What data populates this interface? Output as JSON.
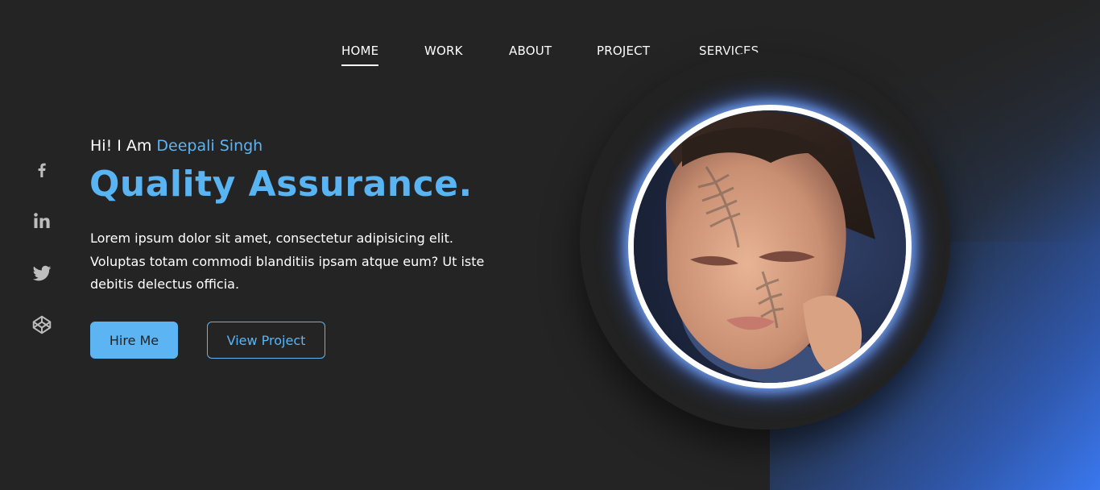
{
  "nav": {
    "items": [
      {
        "label": "HOME",
        "active": true
      },
      {
        "label": "WORK",
        "active": false
      },
      {
        "label": "ABOUT",
        "active": false
      },
      {
        "label": "PROJECT",
        "active": false
      },
      {
        "label": "SERVICES",
        "active": false
      }
    ]
  },
  "social": [
    {
      "icon": "facebook-icon"
    },
    {
      "icon": "linkedin-icon"
    },
    {
      "icon": "twitter-icon"
    },
    {
      "icon": "codepen-icon"
    }
  ],
  "hero": {
    "greeting_prefix": "Hi! I Am ",
    "name": "Deepali Singh",
    "headline": "Quality Assurance.",
    "description": "Lorem ipsum dolor sit amet, consectetur adipisicing elit. Voluptas totam commodi blanditiis ipsam atque eum? Ut iste debitis delectus officia.",
    "hire_label": "Hire Me",
    "view_label": "View Project"
  },
  "profile_image": {
    "icon": "profile-photo"
  },
  "colors": {
    "accent": "#5cb4f2",
    "background": "#242424",
    "gradient_end": "#3a78ef",
    "glow": "#78aaff"
  }
}
